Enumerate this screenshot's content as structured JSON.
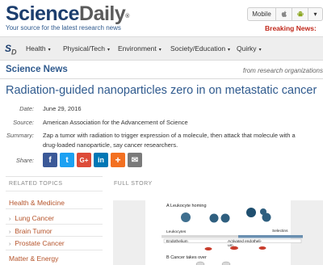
{
  "header": {
    "logo_science": "Science",
    "logo_daily": "Daily",
    "logo_mark": "®",
    "tagline": "Your source for the latest research news",
    "mobile_label": "Mobile",
    "apple_icon": "",
    "android_icon": "",
    "more_icon": "▾",
    "breaking_news": "Breaking News:"
  },
  "nav": {
    "logo_s": "S",
    "logo_d": "D",
    "items": [
      {
        "label": "Health",
        "caret": "▾"
      },
      {
        "label": "Physical/Tech",
        "caret": "▾"
      },
      {
        "label": "Environment",
        "caret": "▾"
      },
      {
        "label": "Society/Education",
        "caret": "▾"
      },
      {
        "label": "Quirky",
        "caret": "▾"
      }
    ]
  },
  "section": {
    "title": "Science News",
    "subtitle": "from research organizations"
  },
  "article": {
    "headline": "Radiation-guided nanoparticles zero in on metastatic cancer",
    "date_label": "Date:",
    "date": "June 29, 2016",
    "source_label": "Source:",
    "source": "American Association for the Advancement of Science",
    "summary_label": "Summary:",
    "summary": "Zap a tumor with radiation to trigger expression of a molecule, then attack that molecule with a drug-loaded nanoparticle, say cancer researchers.",
    "share_label": "Share:"
  },
  "share": {
    "facebook": "f",
    "twitter": "t",
    "googleplus": "G+",
    "linkedin": "in",
    "more": "+",
    "email": "✉"
  },
  "related": {
    "heading": "RELATED TOPICS",
    "group1": "Health & Medicine",
    "items": [
      "Lung Cancer",
      "Brain Tumor",
      "Prostate Cancer"
    ],
    "group2": "Matter & Energy",
    "chevron": "›"
  },
  "full_story": {
    "heading": "FULL STORY",
    "panel_a": "A  Leukocyte homing",
    "leukocytes": "Leukocytes",
    "selectins": "Selectins",
    "endothelium": "Endothelium",
    "activated": "Activated endotheli-",
    "activated2": "um",
    "panel_b": "B  Cancer takes over"
  },
  "colors": {
    "brand": "#1c3e6e",
    "link": "#2f5a8e",
    "breaking": "#c0271a",
    "topic": "#b5532a"
  }
}
